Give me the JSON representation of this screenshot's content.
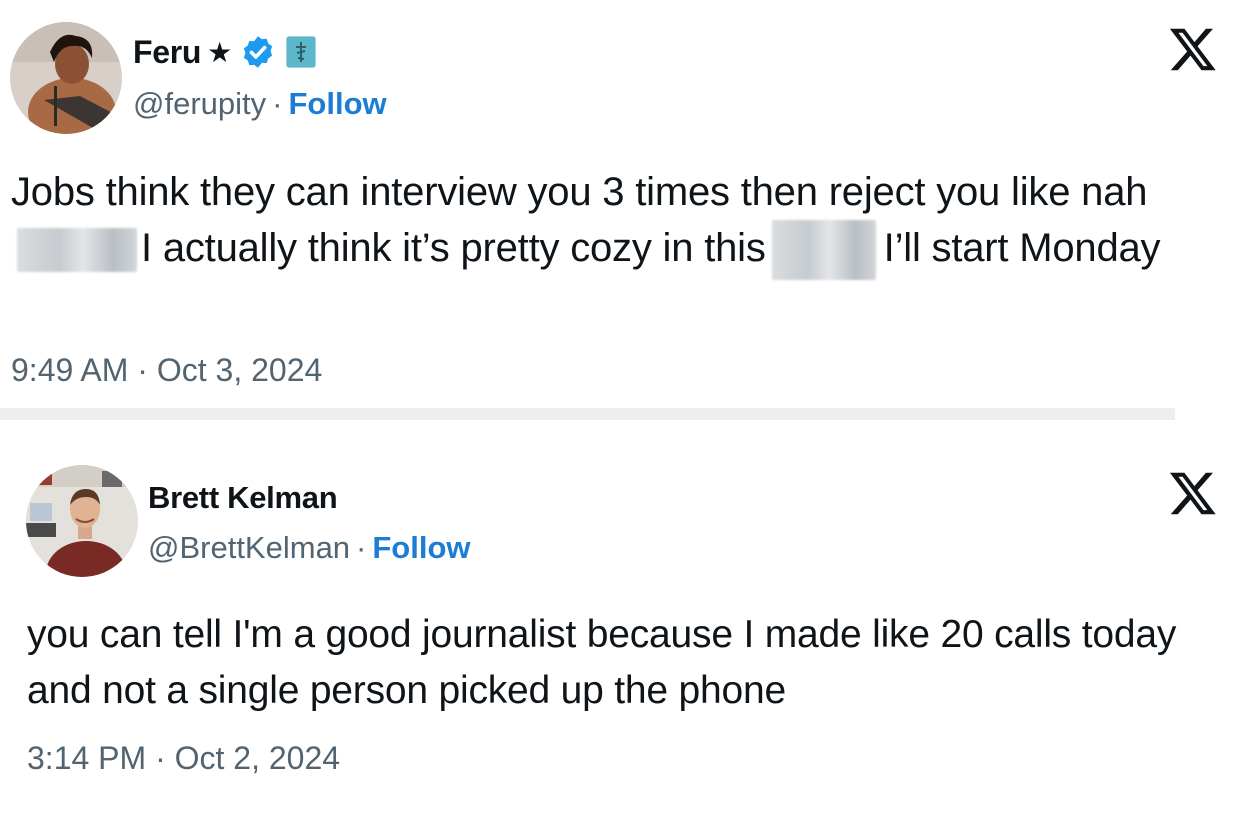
{
  "tweets": [
    {
      "display_name": "Feru",
      "name_suffix": "★",
      "handle": "@ferupity",
      "separator": "·",
      "follow_label": "Follow",
      "text_parts": [
        "Jobs think they can interview you 3 times then reject you like nah",
        "I actually think it’s pretty cozy in this",
        "I’ll start Monday"
      ],
      "timestamp": "9:49 AM · Oct 3, 2024",
      "verified": true
    },
    {
      "display_name": "Brett Kelman",
      "handle": "@BrettKelman",
      "separator": "·",
      "follow_label": "Follow",
      "text": "you can tell I'm a good journalist because I made like 20 calls today and not a single person picked up the phone",
      "timestamp": "3:14 PM · Oct 2, 2024",
      "verified": false
    }
  ],
  "colors": {
    "follow_link": "#1d7dd4",
    "secondary_text": "#536471",
    "verified_badge": "#1d9bf0",
    "divider": "#eceef0"
  },
  "icons": [
    "verified-badge-icon",
    "x-logo-icon",
    "affiliate-badge-icon"
  ]
}
